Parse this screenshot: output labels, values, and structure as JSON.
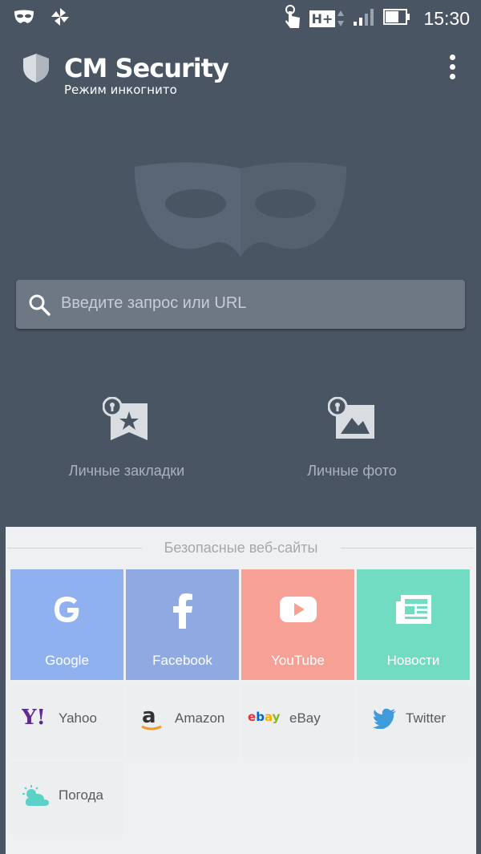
{
  "status_bar": {
    "network": "H+",
    "time": "15:30",
    "icons": [
      "incognito-mask-icon",
      "pinwheel-icon",
      "touch-hand-icon",
      "signal-icon",
      "battery-icon"
    ]
  },
  "header": {
    "title": "CM Security",
    "subtitle": "Режим инкогнито",
    "menu_icon": "more-vert-icon"
  },
  "hero": {
    "icon": "incognito-mask-icon"
  },
  "search": {
    "placeholder": "Введите запрос или URL",
    "icon": "search-icon"
  },
  "features": [
    {
      "label": "Личные закладки",
      "icon": "private-bookmark-icon"
    },
    {
      "label": "Личные фото",
      "icon": "private-photo-icon"
    }
  ],
  "safe_sites": {
    "title": "Безопасные веб-сайты",
    "tiles": [
      {
        "label": "Google",
        "icon": "google-icon",
        "color": "#8fb1f0"
      },
      {
        "label": "Facebook",
        "icon": "facebook-icon",
        "color": "#8fa9e3"
      },
      {
        "label": "YouTube",
        "icon": "youtube-icon",
        "color": "#f6a096"
      },
      {
        "label": "Новости",
        "icon": "news-icon",
        "color": "#71dcc2"
      }
    ],
    "links": [
      {
        "label": "Yahoo",
        "icon": "yahoo-icon"
      },
      {
        "label": "Amazon",
        "icon": "amazon-icon"
      },
      {
        "label": "eBay",
        "icon": "ebay-icon"
      },
      {
        "label": "Twitter",
        "icon": "twitter-icon"
      },
      {
        "label": "Погода",
        "icon": "weather-icon"
      }
    ]
  }
}
